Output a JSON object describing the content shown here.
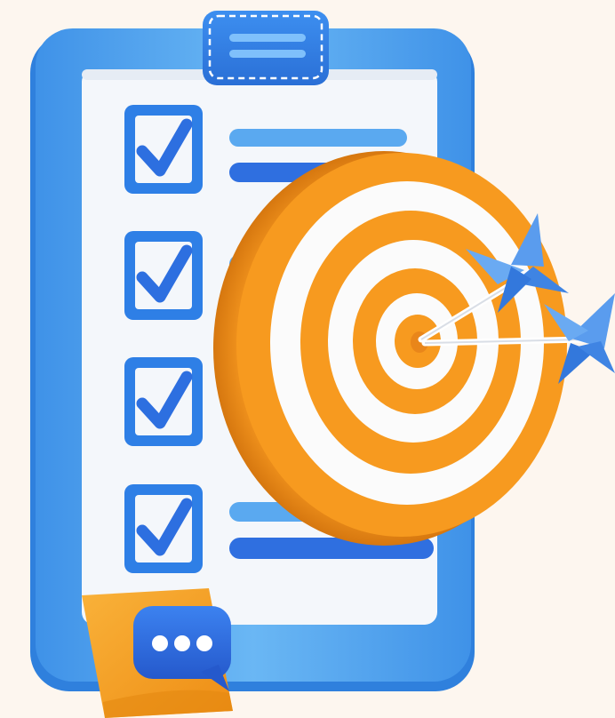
{
  "scene": {
    "subject": "clipboard-with-target-and-darts",
    "background_color": "#fdf6ef",
    "checklist": {
      "checked_items_of_total": [
        4,
        4
      ]
    },
    "target": {
      "darts_in_bullseye": 2
    },
    "icons": [
      "clipboard-icon",
      "checkbox-checked-icon",
      "target-icon",
      "dart-icon",
      "chat-bubble-icon",
      "sticky-note-icon"
    ],
    "colors": {
      "clipboard_blue": "#4aa3ee",
      "clipboard_blue_dark": "#2f7fd8",
      "paper": "#f4f7fb",
      "checkbox_blue": "#2d77e0",
      "target_orange": "#f79a1f",
      "target_orange_dark": "#e9861a",
      "target_white": "#fbfbfb",
      "dart_blue": "#4a90e8",
      "bubble_blue": "#2f6fe0",
      "note_orange": "#f6a423"
    }
  }
}
